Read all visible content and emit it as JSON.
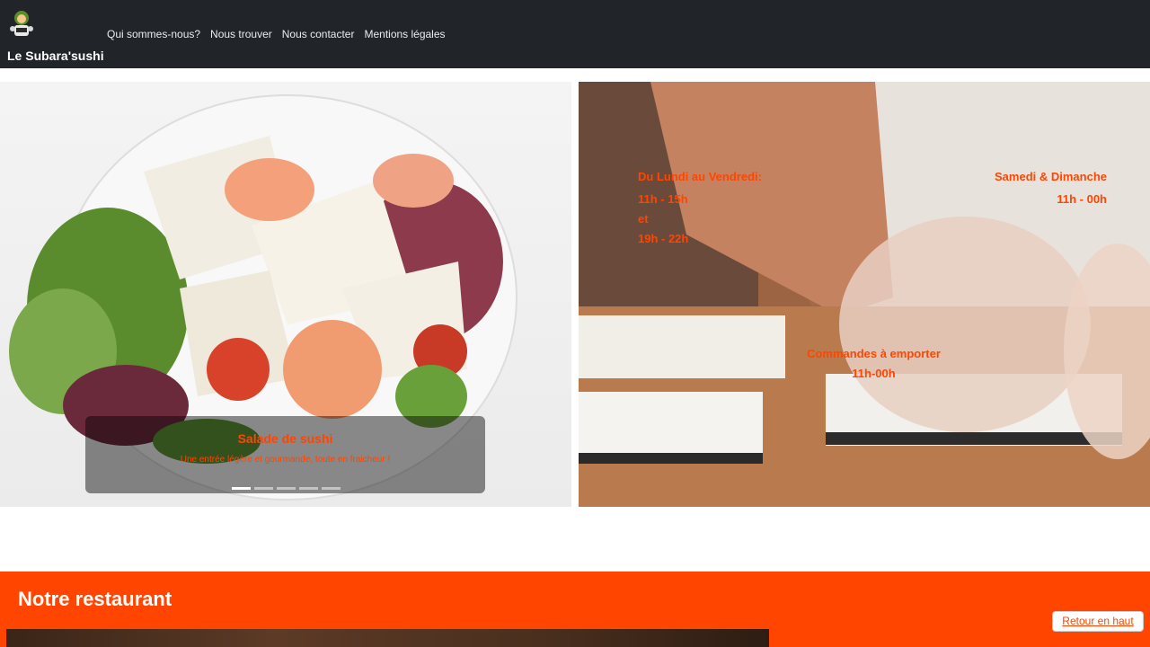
{
  "brand": {
    "name": "Le Subara'sushi",
    "logo_icon": "sushi-chef-logo-icon"
  },
  "nav": {
    "links": [
      {
        "label": "Qui sommes-nous?"
      },
      {
        "label": "Nous trouver"
      },
      {
        "label": "Nous contacter"
      },
      {
        "label": "Mentions légales"
      }
    ]
  },
  "carousel": {
    "caption_title": "Salade de sushi",
    "caption_text": "Une entrée légère et gourmande, toute en fraicheur !",
    "slide_count": 5,
    "active_index": 0
  },
  "hours": {
    "weekday_label": "Du Lundi au Vendredi:",
    "weekday_morning": "11h - 15h",
    "weekday_and": "et",
    "weekday_evening": "19h - 22h",
    "weekend_label": "Samedi & Dimanche",
    "weekend_hours": "11h - 00h",
    "takeaway_label": "Commandes à emporter",
    "takeaway_hours": "11h-00h"
  },
  "section": {
    "title": "Notre restaurant"
  },
  "back_to_top": {
    "label": "Retour en haut"
  },
  "colors": {
    "accent": "#ff4500",
    "navbar": "#212529"
  }
}
